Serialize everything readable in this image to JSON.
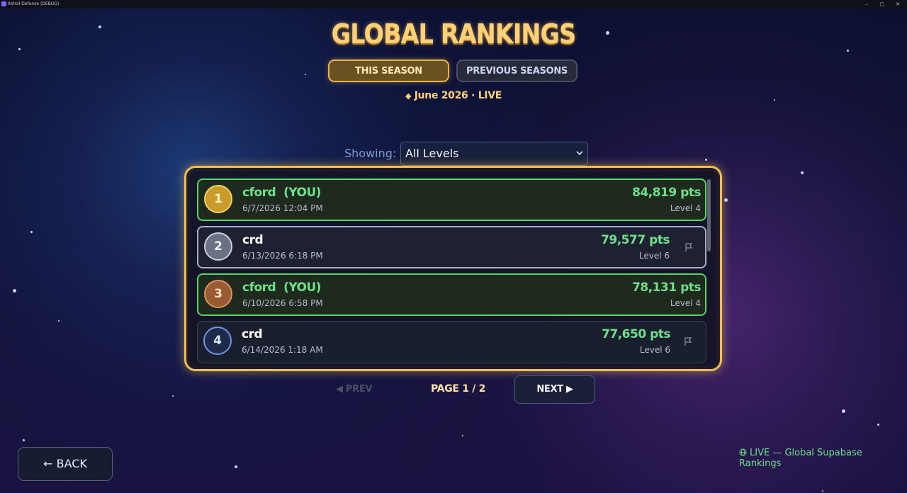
{
  "window": {
    "title": "Astral Defense (DEBUG)",
    "minimize": "–",
    "maximize": "▢",
    "close": "✕"
  },
  "header": {
    "title": "GLOBAL RANKINGS"
  },
  "tabs": [
    {
      "label": "THIS SEASON",
      "active": true
    },
    {
      "label": "PREVIOUS SEASONS",
      "active": false
    }
  ],
  "season": {
    "marker": "◆",
    "label": "June 2026",
    "separator": "·",
    "status": "LIVE"
  },
  "filter": {
    "label": "Showing:",
    "selected": "All Levels"
  },
  "rankings": [
    {
      "rank": "1",
      "name": "cford",
      "tag": "(YOU)",
      "date": "6/7/2026 12:04 PM",
      "points": "84,819 pts",
      "level": "Level 4",
      "you": true
    },
    {
      "rank": "2",
      "name": "crd",
      "tag": "",
      "date": "6/13/2026 6:18 PM",
      "points": "79,577 pts",
      "level": "Level 6",
      "you": false
    },
    {
      "rank": "3",
      "name": "cford",
      "tag": "(YOU)",
      "date": "6/10/2026 6:58 PM",
      "points": "78,131 pts",
      "level": "Level 4",
      "you": true
    },
    {
      "rank": "4",
      "name": "crd",
      "tag": "",
      "date": "6/14/2026 1:18 AM",
      "points": "77,650 pts",
      "level": "Level 6",
      "you": false
    }
  ],
  "pager": {
    "prev": "◀ PREV",
    "info": "PAGE 1 / 2",
    "next": "NEXT ▶"
  },
  "back": {
    "label": "← BACK"
  },
  "footer": {
    "icon": "globe-icon",
    "text": "LIVE — Global Supabase Rankings"
  },
  "colors": {
    "gold": "#f0bf52",
    "you_green": "#59d46a",
    "points_green": "#6ee08a",
    "rank1": "#c89b2a",
    "rank2": "#6b7184",
    "rank3": "#9a5a32",
    "rank4": "#1f2a4a"
  }
}
